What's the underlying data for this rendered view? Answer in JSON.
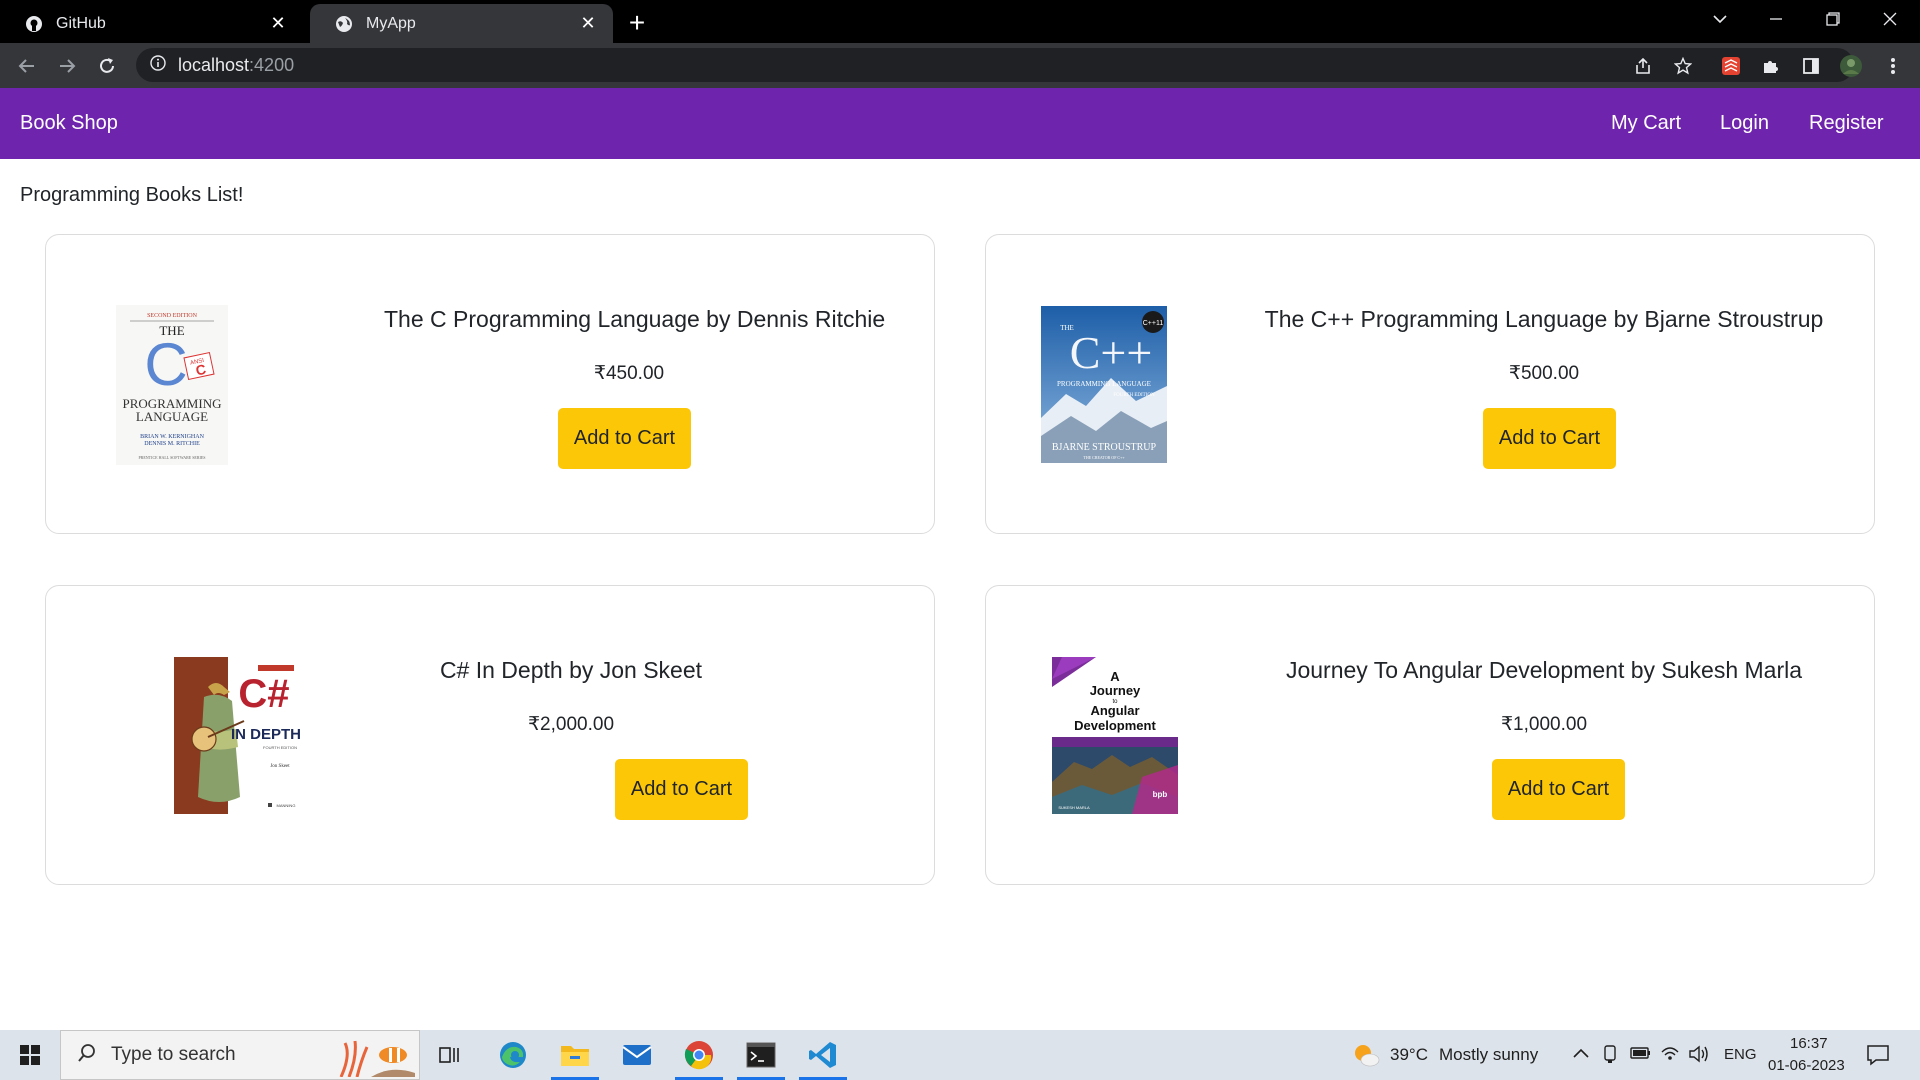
{
  "browser": {
    "tabs": [
      {
        "title": "GitHub",
        "favicon": "github-icon",
        "active": false
      },
      {
        "title": "MyApp",
        "favicon": "globe-icon",
        "active": true
      }
    ],
    "url_host": "localhost",
    "url_port": ":4200"
  },
  "app": {
    "brand": "Book Shop",
    "nav": {
      "cart": "My Cart",
      "login": "Login",
      "register": "Register"
    },
    "heading": "Programming Books List!",
    "add_to_cart_label": "Add to Cart",
    "books": [
      {
        "title": "The C Programming Language by Dennis Ritchie",
        "price": "₹450.00",
        "cover": {
          "edition": "SECOND EDITION",
          "the": "THE",
          "letter": "C",
          "badge": "ANSI",
          "badge_letter": "C",
          "line1": "PROGRAMMING",
          "line2": "LANGUAGE",
          "author1": "BRIAN W. KERNIGHAN",
          "author2": "DENNIS M. RITCHIE",
          "publisher": "PRENTICE HALL SOFTWARE SERIES"
        }
      },
      {
        "title": "The C++ Programming Language by Bjarne Stroustrup",
        "price": "₹500.00",
        "cover": {
          "the": "THE",
          "letter": "C++",
          "badge": "C++11",
          "subtitle": "PROGRAMMING LANGUAGE",
          "edition": "FOURTH EDITION",
          "author": "BJARNE STROUSTRUP",
          "tagline": "THE CREATOR OF C++"
        }
      },
      {
        "title": "C# In Depth by Jon Skeet",
        "price": "₹2,000.00",
        "cover": {
          "letter": "C#",
          "subtitle": "IN DEPTH",
          "edition": "FOURTH EDITION",
          "author": "Jon Skeet",
          "publisher": "MANNING"
        }
      },
      {
        "title": "Journey To Angular Development by Sukesh Marla",
        "price": "₹1,000.00",
        "cover": {
          "line1": "A",
          "line2": "Journey",
          "line3": "to",
          "line4": "Angular",
          "line5": "Development",
          "author": "SUKESH MARLA",
          "publisher": "bpb"
        }
      }
    ]
  },
  "taskbar": {
    "search_placeholder": "Type to search",
    "weather_temp": "39°C",
    "weather_text": "Mostly sunny",
    "language": "ENG",
    "time": "16:37",
    "date": "01-06-2023"
  },
  "colors": {
    "navbar": "#6f24ae",
    "button": "#fbc707",
    "chrome_tabbar": "#000000",
    "chrome_toolbar": "#35363a"
  }
}
